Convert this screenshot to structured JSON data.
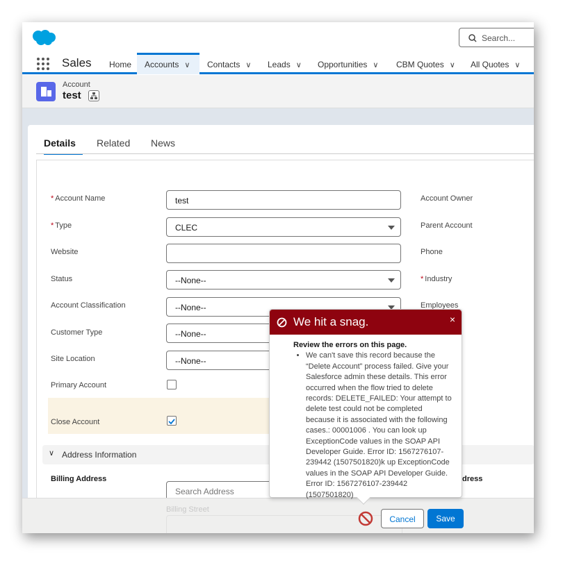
{
  "header": {
    "search_placeholder": "Search...",
    "app_name": "Sales"
  },
  "nav": {
    "tabs": [
      {
        "label": "Home"
      },
      {
        "label": "Accounts",
        "active": true
      },
      {
        "label": "Contacts"
      },
      {
        "label": "Leads"
      },
      {
        "label": "Opportunities"
      },
      {
        "label": "CBM Quotes"
      },
      {
        "label": "All Quotes"
      }
    ]
  },
  "record": {
    "object": "Account",
    "name": "test"
  },
  "detail_tabs": [
    "Details",
    "Related",
    "News"
  ],
  "form": {
    "left": [
      {
        "label": "Account Name",
        "required": true,
        "value": "test"
      },
      {
        "label": "Type",
        "required": true,
        "value": "CLEC"
      },
      {
        "label": "Website",
        "value": ""
      },
      {
        "label": "Status",
        "value": "--None--"
      },
      {
        "label": "Account Classification",
        "value": "--None--"
      },
      {
        "label": "Customer Type",
        "value": "--None--"
      },
      {
        "label": "Site Location",
        "value": "--None--"
      },
      {
        "label": "Primary Account",
        "checked": false
      },
      {
        "label": "Close Account",
        "checked": true
      }
    ],
    "right": [
      "Account Owner",
      "Parent Account",
      "Phone",
      "Industry",
      "Employees"
    ],
    "address_section": "Address Information",
    "billing_label": "Billing Address",
    "shipping_label_partial": "dress",
    "search_address_placeholder": "Search Address",
    "billing_street_label": "Billing Street"
  },
  "error": {
    "title": "We hit a snag.",
    "subtitle": "Review the errors on this page.",
    "message": "We can't save this record because the “Delete Account” process failed. Give your Salesforce admin these details. This error occurred when the flow tried to delete records: DELETE_FAILED: Your attempt to delete test could not be completed because it is associated with the following cases.: 00001006 . You can look up ExceptionCode values in the SOAP API Developer Guide. Error ID: 1567276107-239442 (1507501820)k up ExceptionCode values in the SOAP API Developer Guide. Error ID: 1567276107-239442 (1507501820)",
    "close": "×"
  },
  "footer": {
    "cancel": "Cancel",
    "save": "Save"
  },
  "colors": {
    "brand": "#0176d3",
    "error_header": "#8e030f",
    "icon": "#5867e8",
    "logo": "#00a1e0"
  }
}
